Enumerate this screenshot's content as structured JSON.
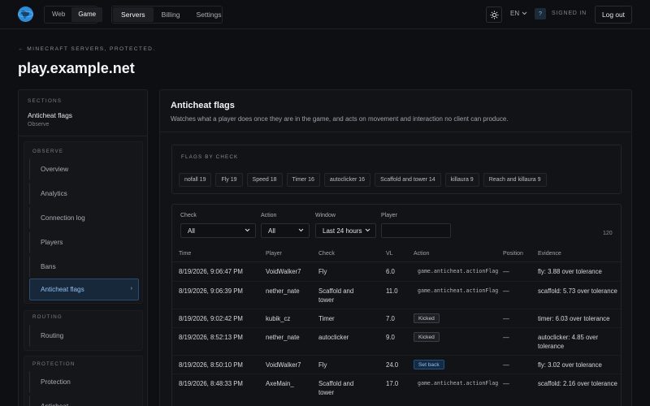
{
  "topbar": {
    "mode_tabs": [
      "Web",
      "Game"
    ],
    "mode_active": "Game",
    "nav_tabs": [
      "Servers",
      "Billing",
      "Settings"
    ],
    "nav_active": "Servers",
    "language": "EN",
    "help_label": "?",
    "signed_in_label": "SIGNED IN",
    "logout_label": "Log out"
  },
  "header": {
    "breadcrumb": "← MINECRAFT SERVERS, PROTECTED.",
    "title": "play.example.net"
  },
  "sidebar": {
    "sections_label": "SECTIONS",
    "current_section": "Anticheat flags",
    "current_group": "Observe",
    "groups": [
      {
        "label": "OBSERVE",
        "items": [
          "Overview",
          "Analytics",
          "Connection log",
          "Players",
          "Bans",
          "Anticheat flags"
        ]
      },
      {
        "label": "ROUTING",
        "items": [
          "Routing"
        ]
      },
      {
        "label": "PROTECTION",
        "items": [
          "Protection",
          "Anticheat"
        ]
      }
    ],
    "active_item": "Anticheat flags"
  },
  "main": {
    "title": "Anticheat flags",
    "description": "Watches what a player does once they are in the game, and acts on movement and interaction no client can produce.",
    "flags_label": "FLAGS BY CHECK",
    "flag_chips": [
      "nofall 19",
      "Fly 19",
      "Speed 18",
      "Timer 16",
      "autoclicker 16",
      "Scaffold and tower 14",
      "killaura 9",
      "Reach and killaura 9"
    ],
    "filters": {
      "check_label": "Check",
      "check_value": "All",
      "action_label": "Action",
      "action_value": "All",
      "window_label": "Window",
      "window_value": "Last 24 hours",
      "player_label": "Player",
      "player_value": ""
    },
    "count": "120",
    "columns": [
      "Time",
      "Player",
      "Check",
      "VL",
      "Action",
      "Position",
      "Evidence"
    ],
    "rows": [
      {
        "time": "8/19/2026, 9:06:47 PM",
        "player": "VoidWalker7",
        "check": "Fly",
        "vl": "6.0",
        "action": "game.anticheat.actionFlag",
        "action_type": "code",
        "position": "—",
        "evidence": "fly: 3.88 over tolerance"
      },
      {
        "time": "8/19/2026, 9:06:39 PM",
        "player": "nether_nate",
        "check": "Scaffold and tower",
        "vl": "11.0",
        "action": "game.anticheat.actionFlag",
        "action_type": "code",
        "position": "—",
        "evidence": "scaffold: 5.73 over tolerance"
      },
      {
        "time": "8/19/2026, 9:02:42 PM",
        "player": "kubik_cz",
        "check": "Timer",
        "vl": "7.0",
        "action": "Kicked",
        "action_type": "kicked",
        "position": "—",
        "evidence": "timer: 6.03 over tolerance"
      },
      {
        "time": "8/19/2026, 8:52:13 PM",
        "player": "nether_nate",
        "check": "autoclicker",
        "vl": "9.0",
        "action": "Kicked",
        "action_type": "kicked",
        "position": "—",
        "evidence": "autoclicker: 4.85 over tolerance"
      },
      {
        "time": "8/19/2026, 8:50:10 PM",
        "player": "VoidWalker7",
        "check": "Fly",
        "vl": "24.0",
        "action": "Set back",
        "action_type": "setback",
        "position": "—",
        "evidence": "fly: 3.02 over tolerance"
      },
      {
        "time": "8/19/2026, 8:48:33 PM",
        "player": "AxeMain_",
        "check": "Scaffold and tower",
        "vl": "17.0",
        "action": "game.anticheat.actionFlag",
        "action_type": "code",
        "position": "—",
        "evidence": "scaffold: 2.16 over tolerance"
      }
    ]
  },
  "colors": {
    "accent": "#2a8fd8",
    "background": "#0e0f12",
    "panel": "#121317",
    "active_nav": "#8fc1f2"
  },
  "icons": [
    "globe-logo-icon",
    "sun-icon",
    "chevron-down-icon",
    "chevron-right-icon"
  ]
}
